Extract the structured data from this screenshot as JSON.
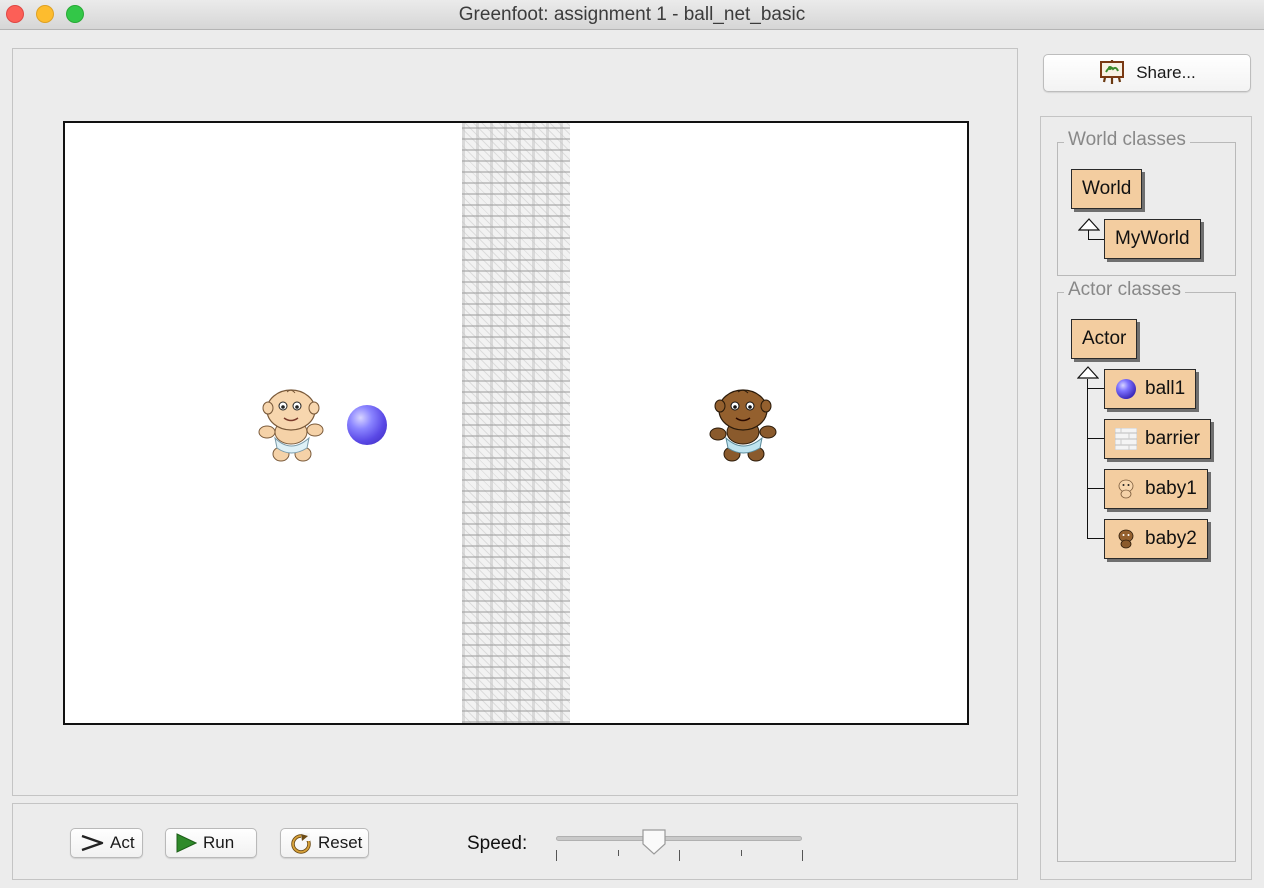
{
  "window": {
    "title": "Greenfoot: assignment 1 - ball_net_basic"
  },
  "world": {
    "actors": [
      "ball1",
      "barrier",
      "baby1",
      "baby2"
    ]
  },
  "controls": {
    "act_label": "Act",
    "run_label": "Run",
    "reset_label": "Reset",
    "speed_label": "Speed:",
    "speed_value": 0.4
  },
  "share": {
    "label": "Share..."
  },
  "class_browser": {
    "world_title": "World classes",
    "world_root": "World",
    "world_classes": [
      "MyWorld"
    ],
    "actor_title": "Actor classes",
    "actor_root": "Actor",
    "actor_classes": [
      "ball1",
      "barrier",
      "baby1",
      "baby2"
    ]
  },
  "colors": {
    "class_box": "#f3cda0",
    "ball": "#6b5cf0",
    "run_icon": "#2f8a2a"
  },
  "icons": {
    "act": "act-arrow-icon",
    "run": "play-triangle-icon",
    "reset": "reset-circular-arrow-icon",
    "share": "easel-picture-icon"
  }
}
